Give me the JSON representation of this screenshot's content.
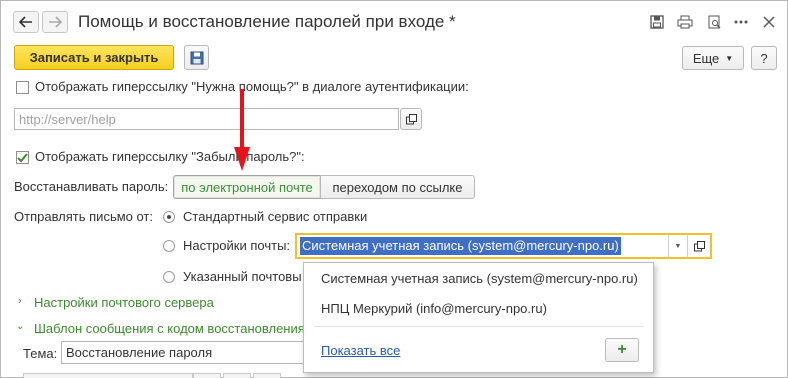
{
  "window": {
    "title": "Помощь и восстановление паролей при входе *"
  },
  "toolbar": {
    "save_close_label": "Записать и закрыть",
    "more_label": "Еще",
    "help_label": "?"
  },
  "form": {
    "show_help_link_label": "Отображать гиперссылку \"Нужна помощь?\" в диалоге аутентификации:",
    "help_url_placeholder": "http://server/help",
    "show_forgot_link_label": "Отображать гиперссылку \"Забыли пароль?\":",
    "restore_label": "Восстанавливать пароль:",
    "restore_options": [
      "по электронной почте",
      "переходом по ссылке"
    ],
    "send_from_label": "Отправлять письмо от:",
    "send_from_options": [
      "Стандартный сервис отправки",
      "Настройки почты:",
      "Указанный почтовы"
    ],
    "mail_account_value": "Системная учетная запись (system@mercury-npo.ru)",
    "section_mail_server": "Настройки почтового сервера",
    "section_template": "Шаблон сообщения с кодом восстановления",
    "subject_label": "Тема:",
    "subject_value": "Восстановление пароля"
  },
  "dropdown": {
    "items": [
      "Системная учетная запись (system@mercury-npo.ru)",
      "НПЦ Меркурий (info@mercury-npo.ru)"
    ],
    "show_all": "Показать все",
    "add_label": "+"
  },
  "colors": {
    "primary_button": "#f5cf1f",
    "accent_green": "#3c8a2e",
    "focus_border": "#f0c22a",
    "selection": "#3f6fc4",
    "annotation_arrow": "#e3141b"
  }
}
